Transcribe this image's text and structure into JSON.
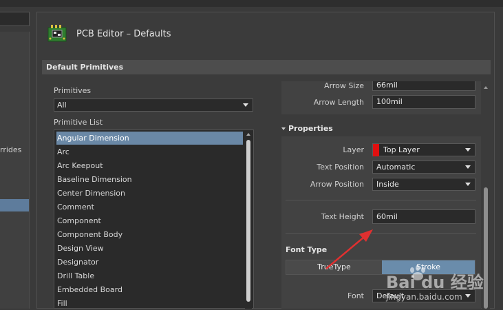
{
  "left_strip": {
    "overrides_fragment": "rrides"
  },
  "dialog": {
    "title": "PCB Editor – Defaults",
    "icon": "pcb-board-icon",
    "section": "Default Primitives"
  },
  "primitives": {
    "label": "Primitives",
    "selected": "All",
    "list_label": "Primitive List",
    "items": [
      "Angular Dimension",
      "Arc",
      "Arc Keepout",
      "Baseline Dimension",
      "Center Dimension",
      "Comment",
      "Component",
      "Component Body",
      "Design View",
      "Designator",
      "Drill Table",
      "Embedded Board",
      "Fill"
    ],
    "selected_index": 0
  },
  "properties": {
    "arrow_size": {
      "label": "Arrow Size",
      "value": "66mil"
    },
    "arrow_length": {
      "label": "Arrow Length",
      "value": "100mil"
    },
    "heading": "Properties",
    "layer": {
      "label": "Layer",
      "value": "Top Layer",
      "color": "#e01010"
    },
    "text_position": {
      "label": "Text Position",
      "value": "Automatic"
    },
    "arrow_position": {
      "label": "Arrow Position",
      "value": "Inside"
    },
    "text_height": {
      "label": "Text Height",
      "value": "60mil"
    },
    "font_type_label": "Font Type",
    "font_type_options": [
      "TrueType",
      "Stroke"
    ],
    "font_type_selected": "Stroke",
    "font": {
      "label": "Font",
      "value": "Default"
    }
  },
  "watermark": {
    "brand": "Bai du 经验",
    "url": "jingyan.baidu.com"
  },
  "colors": {
    "accent": "#6a8cab",
    "selection": "#6a88a6",
    "annotation_arrow": "#e03030"
  }
}
